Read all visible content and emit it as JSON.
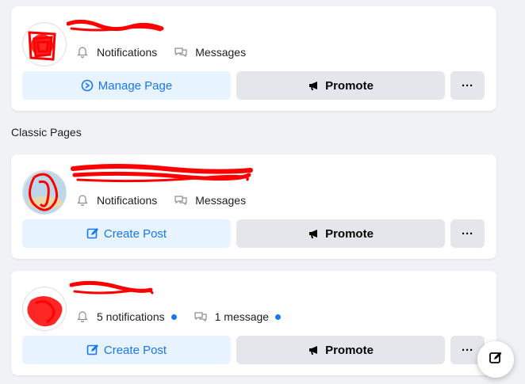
{
  "top_page": {
    "notifications_label": "Notifications",
    "messages_label": "Messages",
    "manage_label": "Manage Page",
    "promote_label": "Promote",
    "more_label": "···"
  },
  "section": {
    "title": "Classic Pages"
  },
  "pages": [
    {
      "notifications_label": "Notifications",
      "messages_label": "Messages",
      "create_label": "Create Post",
      "promote_label": "Promote",
      "more_label": "···"
    },
    {
      "notifications_label": "5 notifications",
      "messages_label": "1 message",
      "create_label": "Create Post",
      "promote_label": "Promote",
      "more_label": "···"
    }
  ],
  "colors": {
    "accent": "#1877f2",
    "accent_bg": "#e7f3ff",
    "button_gray": "#e4e6eb",
    "page_bg": "#f0f2f5",
    "redaction": "#ff0000"
  },
  "icons": {
    "notifications": "bell-icon",
    "messages": "chat-bubble-icon",
    "manage": "manage-page-icon",
    "promote": "megaphone-icon",
    "create": "edit-square-icon",
    "more": "more-dots-icon",
    "compose": "compose-icon"
  }
}
